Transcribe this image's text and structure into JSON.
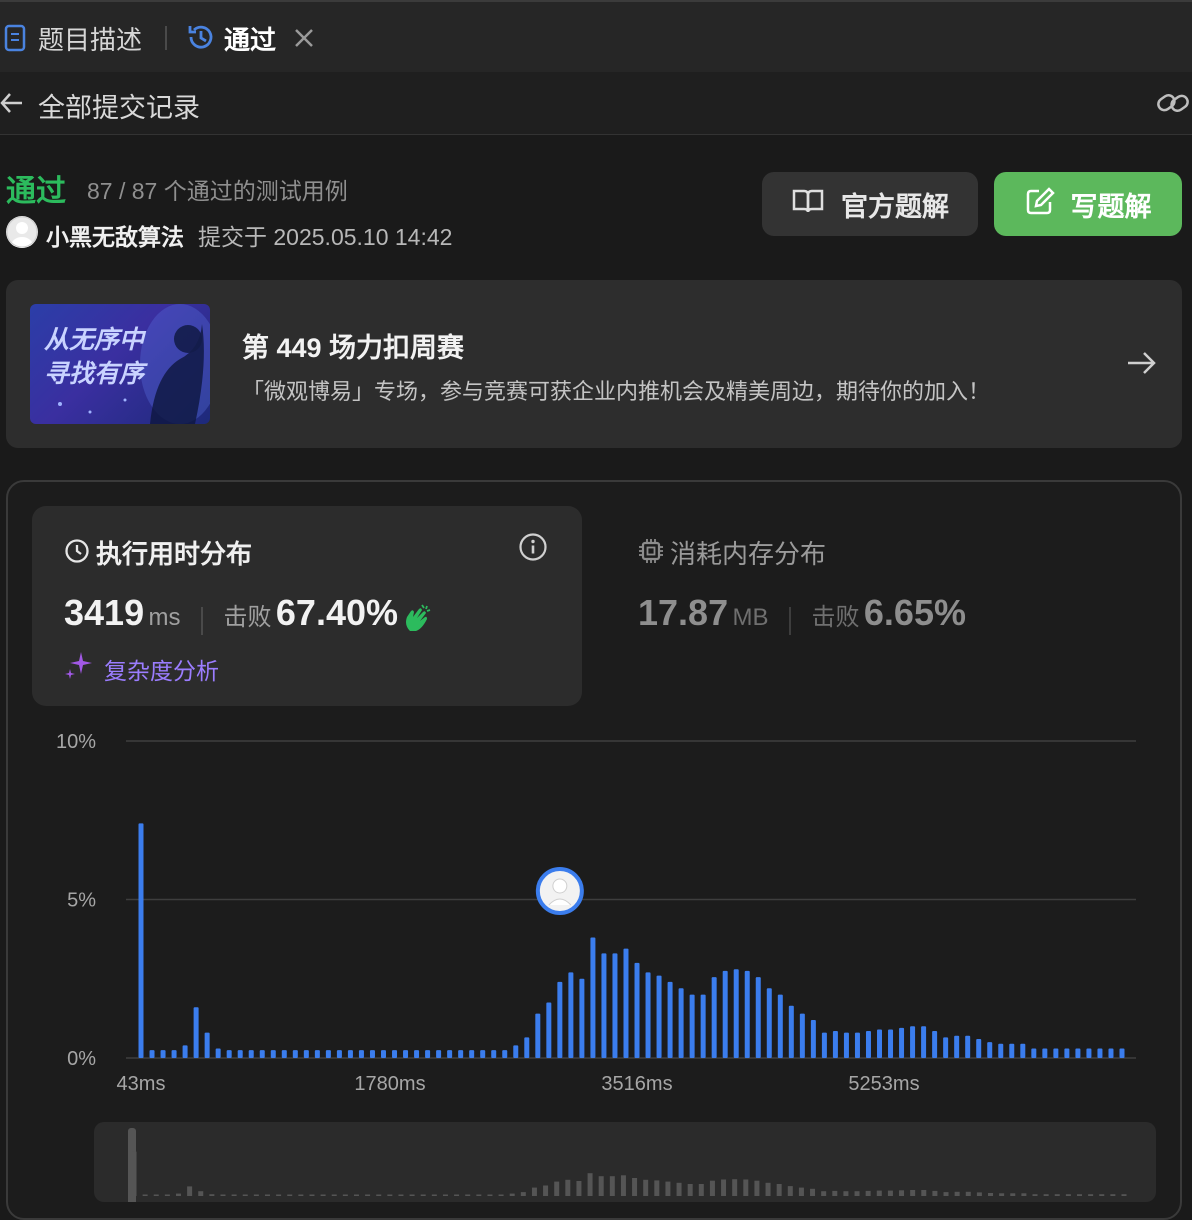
{
  "tabs": [
    {
      "label": "题目描述",
      "icon": "document-icon"
    },
    {
      "label": "通过",
      "icon": "history-icon",
      "active": true
    }
  ],
  "subheader": {
    "back_label": "全部提交记录"
  },
  "submission": {
    "status": "通过",
    "cases": "87 / 87 个通过的测试用例",
    "user": "小黑无敌算法",
    "submitted_at": "提交于 2025.05.10 14:42"
  },
  "buttons": {
    "official_solution": "官方题解",
    "write_solution": "写题解"
  },
  "banner": {
    "image_text_line1": "从无序中",
    "image_text_line2": "寻找有序",
    "title": "第 449 场力扣周赛",
    "subtitle": "「微观博易」专场，参与竞赛可获企业内推机会及精美周边，期待你的加入！"
  },
  "runtime": {
    "title": "执行用时分布",
    "value": "3419",
    "unit": "ms",
    "beats_label": "击败",
    "beats": "67.40%",
    "analysis_label": "复杂度分析"
  },
  "memory": {
    "title": "消耗内存分布",
    "value": "17.87",
    "unit": "MB",
    "beats_label": "击败",
    "beats": "6.65%"
  },
  "colors": {
    "accent_green": "#2cbb5d",
    "bar_blue": "#3b7ded",
    "button_green": "#5cb85c"
  },
  "chart_data": {
    "type": "bar",
    "ylabels": [
      "10%",
      "5%",
      "0%"
    ],
    "xlabels": [
      "43ms",
      "1780ms",
      "3516ms",
      "5253ms"
    ],
    "ylim": [
      0,
      10
    ],
    "grid": true,
    "marker_index": 38,
    "values": [
      7.4,
      0.25,
      0.25,
      0.25,
      0.4,
      1.6,
      0.8,
      0.3,
      0.25,
      0.25,
      0.25,
      0.25,
      0.25,
      0.25,
      0.25,
      0.25,
      0.25,
      0.25,
      0.25,
      0.25,
      0.25,
      0.25,
      0.25,
      0.25,
      0.25,
      0.25,
      0.25,
      0.25,
      0.25,
      0.25,
      0.25,
      0.25,
      0.25,
      0.25,
      0.4,
      0.65,
      1.4,
      1.75,
      2.4,
      2.7,
      2.5,
      3.8,
      3.3,
      3.3,
      3.45,
      3.0,
      2.7,
      2.6,
      2.4,
      2.2,
      2.0,
      2.0,
      2.55,
      2.75,
      2.8,
      2.75,
      2.55,
      2.2,
      2.0,
      1.65,
      1.4,
      1.2,
      0.8,
      0.85,
      0.8,
      0.8,
      0.85,
      0.9,
      0.9,
      0.95,
      1.0,
      1.0,
      0.85,
      0.65,
      0.7,
      0.7,
      0.6,
      0.5,
      0.45,
      0.45,
      0.45,
      0.3,
      0.3,
      0.3,
      0.3,
      0.3,
      0.3,
      0.3,
      0.3,
      0.3
    ]
  }
}
